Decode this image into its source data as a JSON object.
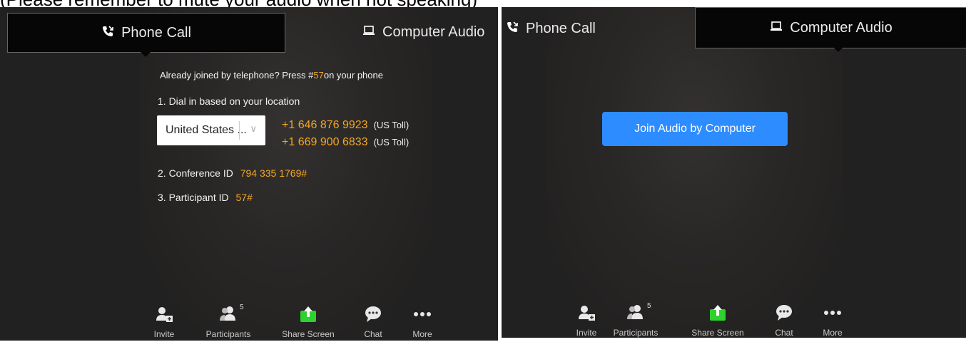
{
  "caption": "(Please remember to mute your audio when not speaking)",
  "tabs": {
    "phone": "Phone Call",
    "computer": "Computer Audio"
  },
  "phone_panel": {
    "already_joined_pre": "Already joined by telephone? Press #",
    "already_joined_code": "57",
    "already_joined_post": "on your phone",
    "step1": "1. Dial in based on your location",
    "country_select": "United States ...",
    "numbers": [
      {
        "number": "+1 646 876 9923",
        "note": "(US Toll)"
      },
      {
        "number": "+1 669 900 6833",
        "note": "(US Toll)"
      }
    ],
    "step2_label": "2. Conference ID",
    "conference_id": "794 335 1769",
    "step3_label": "3. Participant ID",
    "participant_id": "57",
    "hash": "#"
  },
  "computer_panel": {
    "join_button": "Join Audio by Computer"
  },
  "toolbar": {
    "invite": "Invite",
    "participants": "Participants",
    "participant_count": "5",
    "share": "Share Screen",
    "chat": "Chat",
    "more": "More"
  },
  "colors": {
    "accent_orange": "#f5a623",
    "button_blue": "#2d8cff",
    "share_green": "#2fd12f"
  }
}
